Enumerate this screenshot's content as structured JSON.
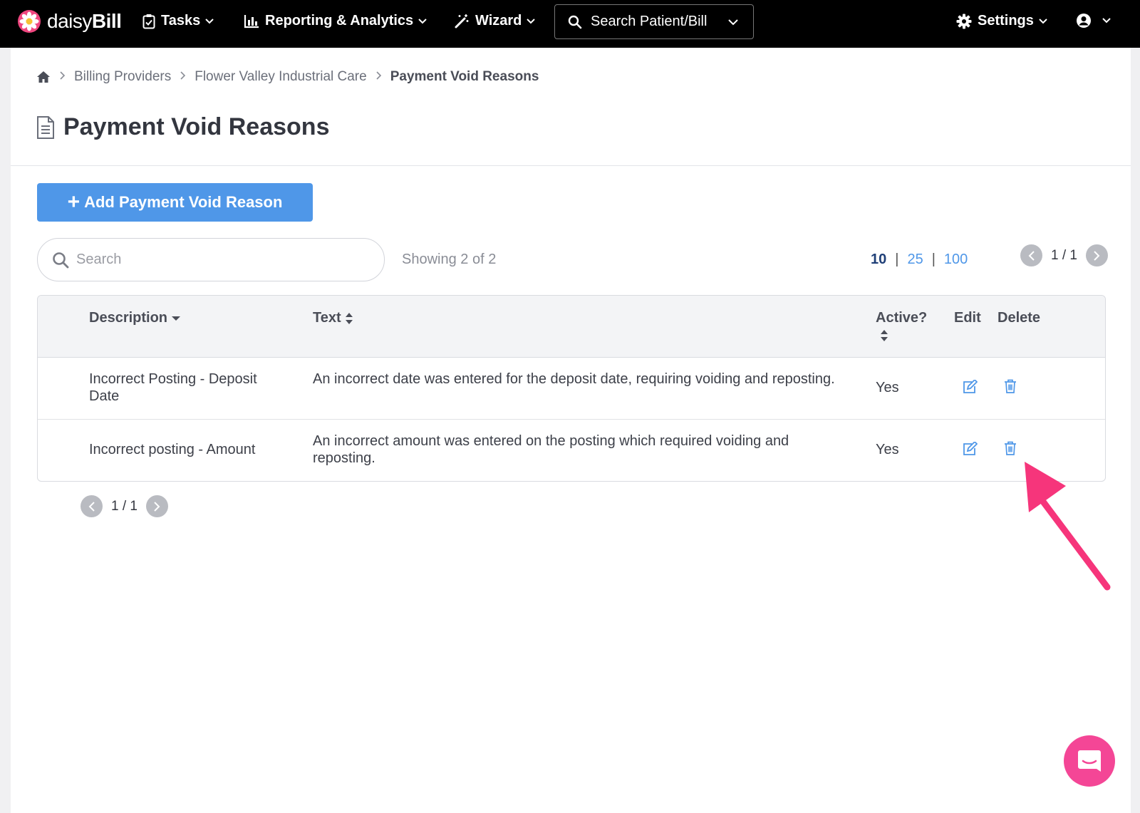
{
  "brand": {
    "name_light": "daisy",
    "name_bold": "Bill"
  },
  "nav": {
    "tasks": "Tasks",
    "reporting": "Reporting & Analytics",
    "wizard": "Wizard",
    "search": "Search Patient/Bill",
    "settings": "Settings"
  },
  "breadcrumb": {
    "items": [
      "Billing Providers",
      "Flower Valley Industrial Care"
    ],
    "current": "Payment Void Reasons"
  },
  "page": {
    "title": "Payment Void Reasons",
    "add_button": "Add Payment Void Reason"
  },
  "toolbar": {
    "search_placeholder": "Search",
    "showing": "Showing 2 of 2",
    "page_sizes": [
      "10",
      "25",
      "100"
    ],
    "active_page_size": "10",
    "pager": "1 / 1"
  },
  "table": {
    "headers": {
      "description": "Description",
      "text": "Text",
      "active": "Active?",
      "edit": "Edit",
      "delete": "Delete"
    },
    "rows": [
      {
        "description": "Incorrect Posting - Deposit Date",
        "text": "An incorrect date was entered for the deposit date, requiring voiding and reposting.",
        "active": "Yes"
      },
      {
        "description": "Incorrect posting - Amount",
        "text": "An incorrect amount was entered on the posting which required voiding and reposting.",
        "active": "Yes"
      }
    ]
  },
  "footer_pager": "1 / 1",
  "colors": {
    "primary": "#4f97e8",
    "annotation_arrow": "#f6357b",
    "chat": "#f44696",
    "topbar": "#000000"
  }
}
